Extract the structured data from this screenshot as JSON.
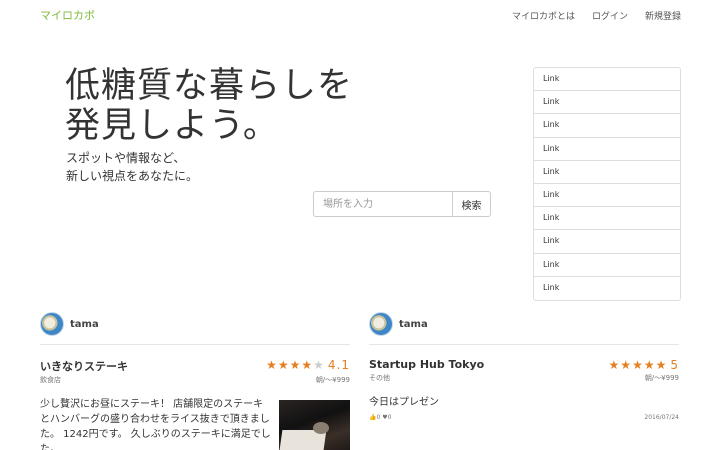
{
  "nav": {
    "brand": "マイロカボ",
    "links": [
      "マイロカボとは",
      "ログイン",
      "新規登録"
    ]
  },
  "hero": {
    "title_line1": "低糖質な暮らしを",
    "title_line2": "発見しよう。",
    "sub_line1": "スポットや情報など、",
    "sub_line2": "新しい視点をあなたに。"
  },
  "search": {
    "placeholder": "場所を入力",
    "button_label": "検索"
  },
  "links": [
    "Link",
    "Link",
    "Link",
    "Link",
    "Link",
    "Link",
    "Link",
    "Link",
    "Link",
    "Link"
  ],
  "cards": [
    {
      "user": "tama",
      "shop_name": "いきなりステーキ",
      "category": "飲食店",
      "rating": 4.1,
      "rating_text": "4.1",
      "stars_filled": 4,
      "price": "朝/〜¥999",
      "review": "少し贅沢にお昼にステーキ！ 店舗限定のステーキとハンバーグの盛り合わせをライス抜きで頂きました。 1242円です。 久しぶりのステーキに満足でした。"
    },
    {
      "user": "tama",
      "shop_name": "Startup Hub Tokyo",
      "category": "その他",
      "rating": 5,
      "rating_text": "5",
      "stars_filled": 5,
      "price": "朝/〜¥999",
      "review": "今日はプレゼン",
      "likes": "0",
      "hearts": "0",
      "date": "2016/07/24"
    }
  ],
  "colors": {
    "brand": "#7dbb3c",
    "star": "#e67e22"
  }
}
